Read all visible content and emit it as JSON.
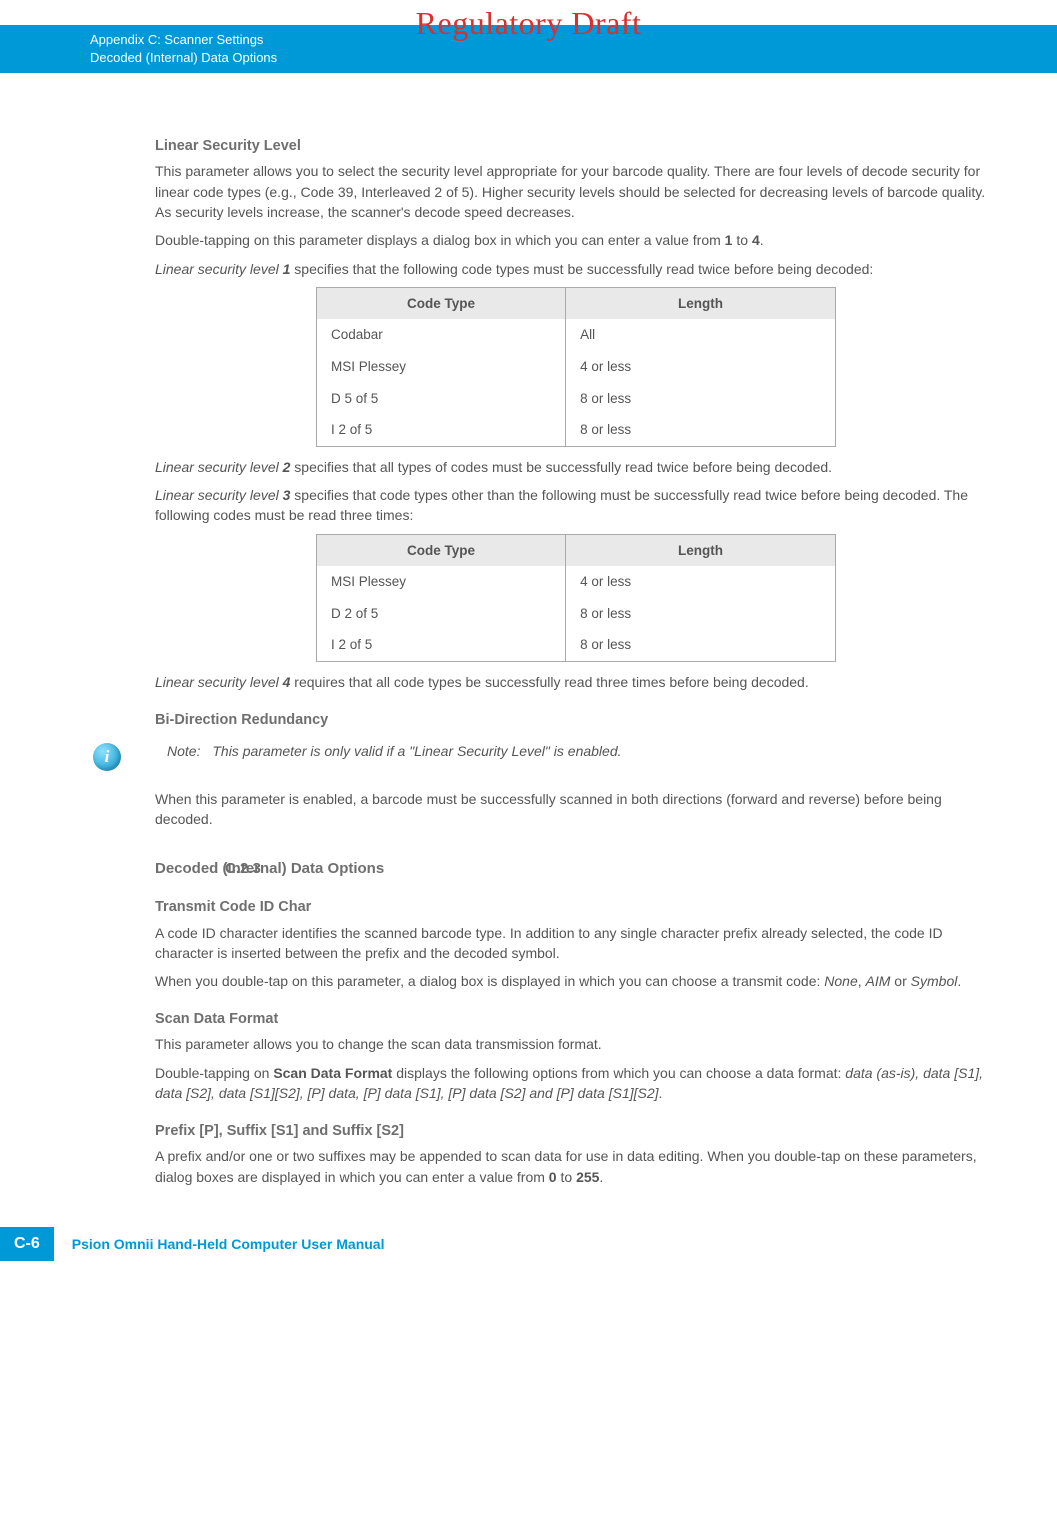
{
  "watermark": "Regulatory Draft",
  "header": {
    "line1": "Appendix C: Scanner Settings",
    "line2": "Decoded (Internal) Data Options"
  },
  "s1": {
    "h": "Linear Security Level",
    "p1": "This parameter allows you to select the security level appropriate for your barcode quality. There are four levels of decode security for linear code types (e.g., Code 39, Interleaved 2 of 5). Higher security levels should be selected for decreasing levels of barcode quality. As security levels increase, the scanner's decode speed decreases.",
    "p2a": "Double-tapping on this parameter displays a dialog box in which you can enter a value from ",
    "p2b": "1",
    "p2c": " to ",
    "p2d": "4",
    "p2e": ".",
    "p3a": "Linear security level ",
    "p3b": "1",
    "p3c": " specifies that the following code types must be successfully read twice before being decoded:"
  },
  "t1": {
    "h1": "Code Type",
    "h2": "Length",
    "r": [
      [
        "Codabar",
        "All"
      ],
      [
        "MSI Plessey",
        "4 or less"
      ],
      [
        "D 5 of 5",
        "8 or less"
      ],
      [
        "I 2 of 5",
        "8 or less"
      ]
    ]
  },
  "s2": {
    "p1a": "Linear security level ",
    "p1b": "2",
    "p1c": " specifies that all types of codes must be successfully read twice before being decoded.",
    "p2a": "Linear security level ",
    "p2b": "3",
    "p2c": " specifies that code types other than the following must be successfully read twice before being decoded. The following codes must be read three times:"
  },
  "t2": {
    "h1": "Code Type",
    "h2": "Length",
    "r": [
      [
        "MSI Plessey",
        "4 or less"
      ],
      [
        "D 2 of 5",
        "8 or less"
      ],
      [
        "I 2 of 5",
        "8 or less"
      ]
    ]
  },
  "s3": {
    "p1a": "Linear security level ",
    "p1b": "4",
    "p1c": " requires that all code types be successfully read three times before being decoded."
  },
  "bdr": {
    "h": "Bi-Direction Redundancy",
    "noteLabel": "Note:",
    "noteText": "This parameter is only valid if a \"Linear Security Level\" is enabled.",
    "p": "When this parameter is enabled, a barcode must be successfully scanned in both directions (forward and reverse) before being decoded."
  },
  "sec23": {
    "num": "C.2.3",
    "title": "Decoded (Internal) Data Options"
  },
  "tcc": {
    "h": "Transmit Code ID Char",
    "p1": "A code ID character identifies the scanned barcode type. In addition to any single character prefix already selected, the code ID character is inserted between the prefix and the decoded symbol.",
    "p2a": "When you double-tap on this parameter, a dialog box is displayed in which you can choose a transmit code: ",
    "p2b": "None",
    "p2c": ", ",
    "p2d": "AIM",
    "p2e": " or ",
    "p2f": "Symbol",
    "p2g": "."
  },
  "sdf": {
    "h": "Scan Data Format",
    "p1": "This parameter allows you to change the scan data transmission format.",
    "p2a": "Double-tapping on ",
    "p2b": "Scan Data Format",
    "p2c": " displays the following options from which you can choose a data format: ",
    "p2d": "data (as-is), data [S1], data [S2], data [S1][S2], [P] data, [P] data [S1], [P] data [S2] and [P] data [S1][S2]",
    "p2e": "."
  },
  "pss": {
    "h": "Prefix [P], Suffix [S1] and Suffix [S2]",
    "p1a": "A prefix and/or one or two suffixes may be appended to scan data for use in data editing. When you double-tap on these parameters, dialog boxes are displayed in which you can enter a value from ",
    "p1b": "0",
    "p1c": " to ",
    "p1d": "255",
    "p1e": "."
  },
  "footer": {
    "page": "C-6",
    "text": "Psion Omnii Hand-Held Computer User Manual"
  }
}
